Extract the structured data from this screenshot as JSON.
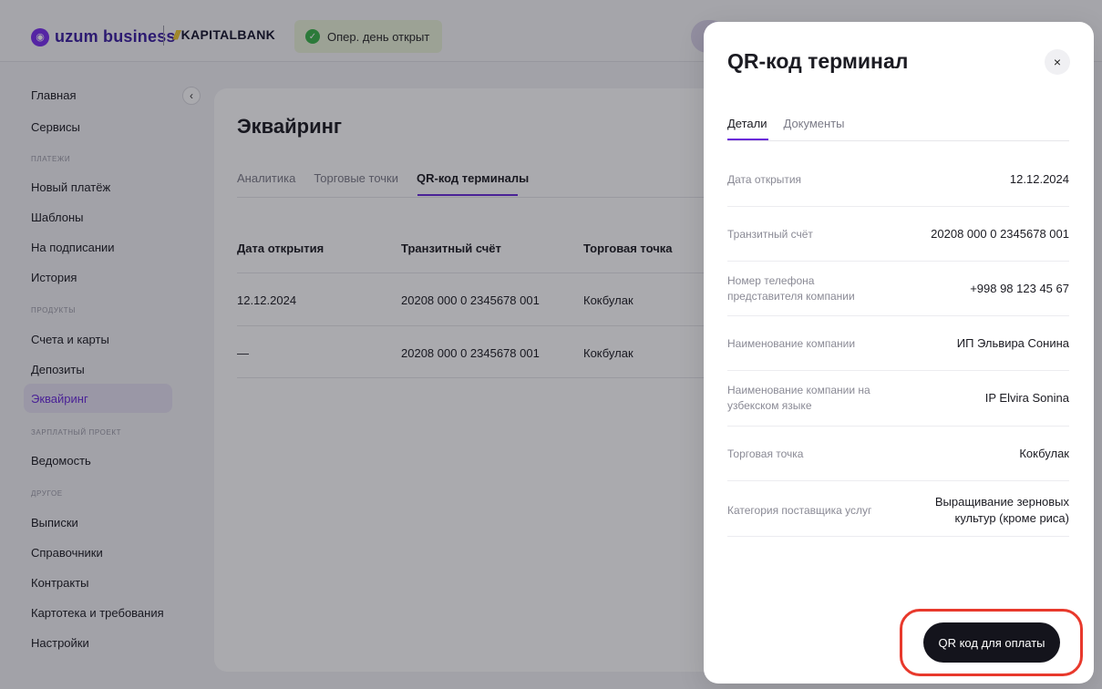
{
  "header": {
    "brand": "uzum business",
    "brand_icon": "uzum-logo-icon",
    "partner": "KAPITALBANK",
    "partner_mark": "///",
    "day_status": "Опер. день открыт"
  },
  "sidebar": {
    "items": [
      {
        "label": "Главная"
      },
      {
        "label": "Сервисы"
      },
      {
        "group": "ПЛАТЕЖИ"
      },
      {
        "label": "Новый платёж"
      },
      {
        "label": "Шаблоны"
      },
      {
        "label": "На подписании"
      },
      {
        "label": "История"
      },
      {
        "group": "ПРОДУКТЫ"
      },
      {
        "label": "Счета и карты"
      },
      {
        "label": "Депозиты"
      },
      {
        "label": "Эквайринг",
        "active": true
      },
      {
        "group": "ЗАРПЛАТНЫЙ ПРОЕКТ"
      },
      {
        "label": "Ведомость"
      },
      {
        "group": "ДРУГОЕ"
      },
      {
        "label": "Выписки"
      },
      {
        "label": "Справочники"
      },
      {
        "label": "Контракты"
      },
      {
        "label": "Картотека и требования"
      },
      {
        "label": "Настройки"
      }
    ]
  },
  "main": {
    "title": "Эквайринг",
    "tabs": [
      {
        "label": "Аналитика"
      },
      {
        "label": "Торговые точки"
      },
      {
        "label": "QR-код терминалы",
        "active": true
      }
    ],
    "table": {
      "headers": [
        "Дата открытия",
        "Транзитный счёт",
        "Торговая точка"
      ],
      "rows": [
        [
          "12.12.2024",
          "20208 000 0 2345678 001",
          "Кокбулак"
        ],
        [
          "—",
          "20208 000 0 2345678 001",
          "Кокбулак"
        ]
      ]
    }
  },
  "drawer": {
    "title": "QR-код терминал",
    "close": "×",
    "tabs": [
      {
        "label": "Детали",
        "active": true
      },
      {
        "label": "Документы"
      }
    ],
    "fields": [
      {
        "label": "Дата открытия",
        "value": "12.12.2024"
      },
      {
        "label": "Транзитный счёт",
        "value": "20208 000 0 2345678 001"
      },
      {
        "label": "Номер телефона представителя компании",
        "value": "+998 98 123 45 67"
      },
      {
        "label": "Наименование компании",
        "value": "ИП Эльвира Сонина"
      },
      {
        "label": "Наименование компании на узбекском языке",
        "value": "IP Elvira Sonina"
      },
      {
        "label": "Торговая точка",
        "value": "Кокбулак"
      },
      {
        "label": "Категория поставщика услуг",
        "value": "Выращивание зерновых культур (кроме риса)"
      }
    ],
    "qr_button": "QR код для оплаты"
  },
  "colors": {
    "accent": "#6a2bd9",
    "button": "#14141c",
    "highlight": "#e8392c",
    "status_ok": "#3bb54a"
  }
}
